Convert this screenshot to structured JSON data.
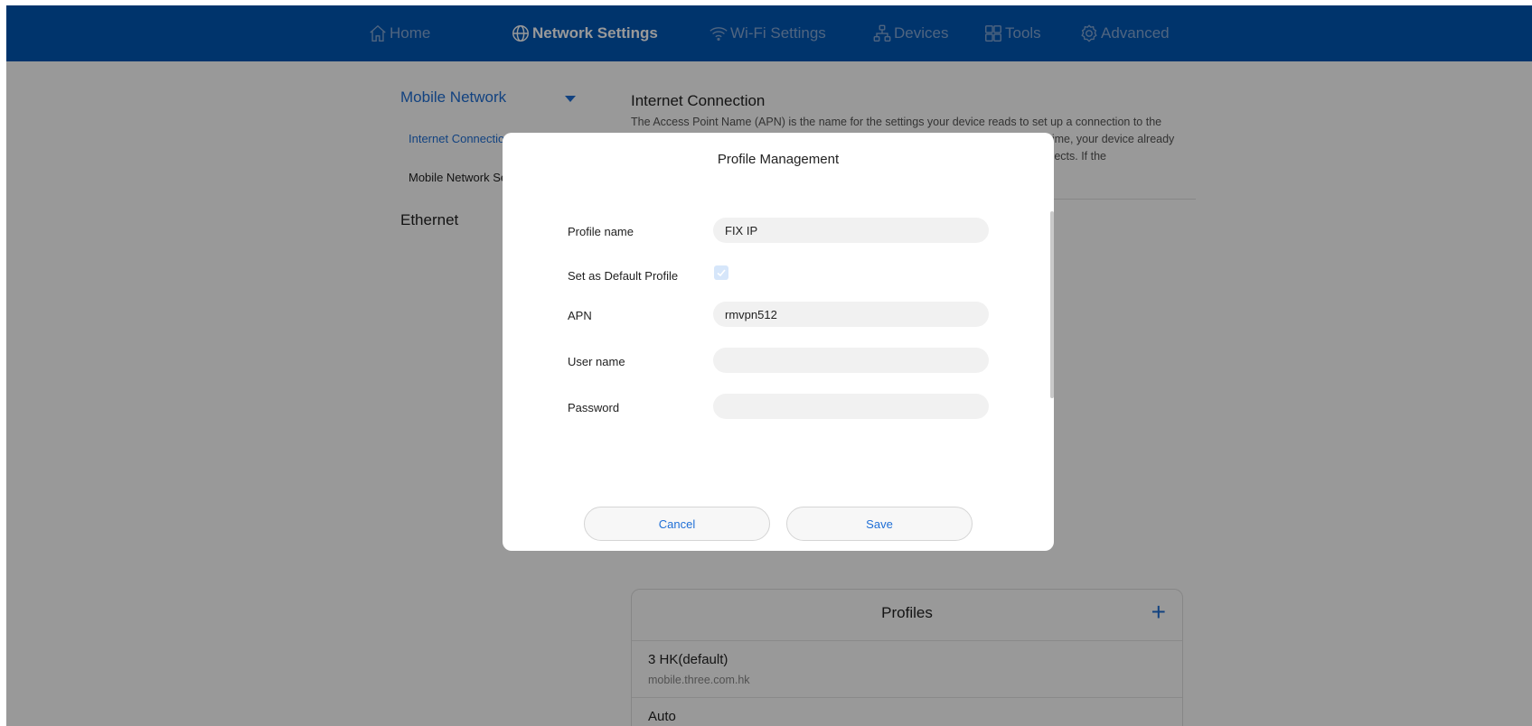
{
  "nav": {
    "items": [
      {
        "label": "Home",
        "icon": "home-icon"
      },
      {
        "label": "Network Settings",
        "icon": "globe-icon",
        "active": true
      },
      {
        "label": "Wi-Fi Settings",
        "icon": "wifi-icon"
      },
      {
        "label": "Devices",
        "icon": "devices-icon"
      },
      {
        "label": "Tools",
        "icon": "tools-icon"
      },
      {
        "label": "Advanced",
        "icon": "gear-icon"
      }
    ]
  },
  "sidebar": {
    "section": "Mobile Network",
    "items": [
      "Internet Connection",
      "Mobile Network Search"
    ],
    "section2": "Ethernet"
  },
  "content": {
    "title": "Internet Connection",
    "description": "The Access Point Name (APN) is the name for the settings your device reads to set up a connection to the gateway between your carrier's cellular network and the public Internet. Most of the time, your device already has the APN settings it needs, and they will be configured automatically when it connects. If the"
  },
  "profiles": {
    "title": "Profiles",
    "add_label": "+",
    "list": [
      {
        "name": "3 HK(default)",
        "apn": "mobile.three.com.hk"
      },
      {
        "name": "Auto",
        "apn": ""
      }
    ]
  },
  "modal": {
    "title": "Profile Management",
    "fields": {
      "profile_name": {
        "label": "Profile name",
        "value": "FIX IP"
      },
      "default_profile": {
        "label": "Set as Default Profile",
        "checked": true
      },
      "apn": {
        "label": "APN",
        "value": "rmvpn512"
      },
      "username": {
        "label": "User name",
        "value": ""
      },
      "password": {
        "label": "Password",
        "value": ""
      }
    },
    "cancel_label": "Cancel",
    "save_label": "Save"
  },
  "colors": {
    "topbar": "#0057b5",
    "accent": "#1f6fd6"
  }
}
